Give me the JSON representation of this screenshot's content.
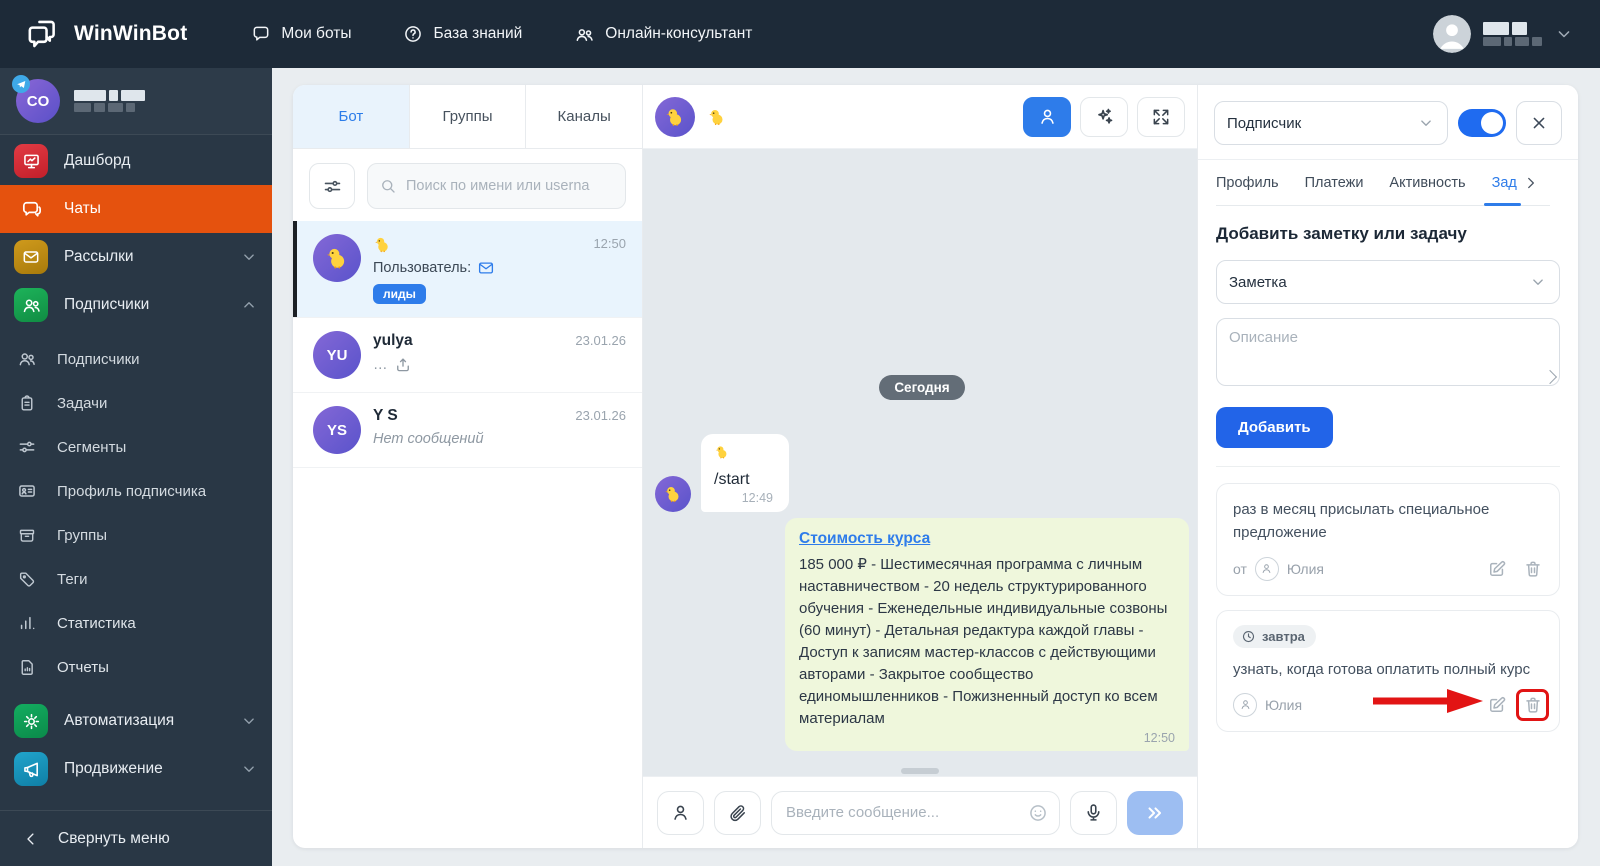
{
  "navbar": {
    "brand": "WinWinBot",
    "items": [
      {
        "label": "Мои боты",
        "icon": "chat-bubble-icon"
      },
      {
        "label": "База знаний",
        "icon": "help-circle-icon"
      },
      {
        "label": "Онлайн-консультант",
        "icon": "people-icon"
      }
    ]
  },
  "sidebar": {
    "profile": {
      "initials": "CO",
      "badge_icon": "telegram-icon"
    },
    "menu": [
      {
        "label": "Дашборд",
        "icon": "dashboard-icon",
        "tile_color": "#d62a33"
      },
      {
        "label": "Чаты",
        "icon": "chats-icon",
        "active": true
      },
      {
        "label": "Рассылки",
        "icon": "mail-icon",
        "tile_color": "#bd8a12",
        "expandable": true
      },
      {
        "label": "Подписчики",
        "icon": "users-icon",
        "tile_color": "#17a24b",
        "expandable": true,
        "expanded": true
      },
      {
        "label": "Подписчики",
        "icon": "user-icon"
      },
      {
        "label": "Задачи",
        "icon": "clipboard-icon"
      },
      {
        "label": "Сегменты",
        "icon": "sliders-icon"
      },
      {
        "label": "Профиль подписчика",
        "icon": "id-card-icon"
      },
      {
        "label": "Группы",
        "icon": "archive-icon"
      },
      {
        "label": "Теги",
        "icon": "tag-icon"
      },
      {
        "label": "Статистика",
        "icon": "bar-chart-icon"
      },
      {
        "label": "Отчеты",
        "icon": "report-icon"
      },
      {
        "label": "Автоматизация",
        "icon": "gear-icon",
        "tile_color": "#0fa058",
        "expandable": true
      },
      {
        "label": "Продвижение",
        "icon": "megaphone-icon",
        "tile_color": "#1894bd",
        "expandable": true
      }
    ],
    "collapse_label": "Свернуть меню"
  },
  "chat_list": {
    "tabs": [
      {
        "label": "Бот",
        "active": true
      },
      {
        "label": "Группы"
      },
      {
        "label": "Каналы"
      }
    ],
    "search_placeholder": "Поиск по имени или userna",
    "chats": [
      {
        "avatar_icon": "chick-icon",
        "title_icon": "chick-icon",
        "subtitle": "Пользователь:",
        "subtitle_icon": "envelope-icon",
        "tag": "лиды",
        "time": "12:50",
        "active": true
      },
      {
        "initials": "YU",
        "title": "yulya",
        "subtitle": "…",
        "subtitle_icon": "upload-icon",
        "time": "23.01.26"
      },
      {
        "initials": "YS",
        "title": "Y S",
        "subtitle": "Нет сообщений",
        "time": "23.01.26"
      }
    ]
  },
  "chat": {
    "header_avatar_icon": "chick-icon",
    "header_title_icon": "chick-icon",
    "date_label": "Сегодня",
    "messages": [
      {
        "direction": "in",
        "emoji_icon": "chick-icon",
        "text": "/start",
        "time": "12:49"
      },
      {
        "direction": "out",
        "link": "Стоимость курса",
        "text": "185 000 ₽ - Шестимесячная программа с личным наставничеством - 20 недель структурированного обучения - Еженедельные индивидуальные созвоны (60 минут) - Детальная редактура каждой главы - Доступ к записям мастер-классов с действующими авторами - Закрытое сообщество единомышленников - Пожизненный доступ ко всем материалам",
        "time": "12:50"
      }
    ],
    "input_placeholder": "Введите сообщение..."
  },
  "panel": {
    "subscriber_value": "Подписчик",
    "toggle_on": true,
    "tabs": [
      {
        "label": "Профиль"
      },
      {
        "label": "Платежи"
      },
      {
        "label": "Активность"
      },
      {
        "label": "Зад",
        "active": true,
        "truncated": true
      }
    ],
    "heading": "Добавить заметку или задачу",
    "note_type_value": "Заметка",
    "desc_placeholder": "Описание",
    "add_label": "Добавить",
    "notes": [
      {
        "text": "раз в месяц присылать специальное предложение",
        "prefix": "от",
        "author": "Юлия"
      },
      {
        "badge": "завтра",
        "badge_icon": "clock-icon",
        "text": "узнать, когда готова оплатить полный курс",
        "author": "Юлия",
        "annotation": "red-arrow-pointing-to-delete"
      }
    ]
  },
  "colors": {
    "navbar_bg": "#1d2a38",
    "sidebar_bg": "#293745",
    "active_orange": "#e5520e",
    "accent_blue": "#2e7cea",
    "button_blue": "#2264e8",
    "outgoing_bubble": "#eff7dc",
    "chat_bg": "#e4e9ed",
    "tag_blue": "#2e7cea",
    "annotation_red": "#e11414"
  }
}
